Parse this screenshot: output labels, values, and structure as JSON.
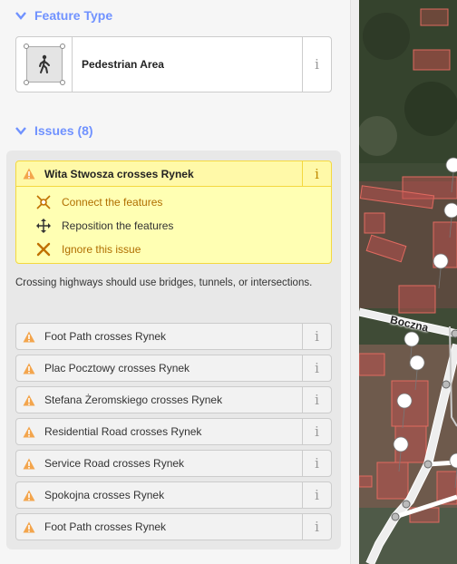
{
  "feature_type": {
    "header": "Feature Type",
    "preset_name": "Pedestrian Area",
    "info_label": "i"
  },
  "issues": {
    "header": "Issues (8)",
    "active": {
      "title": "Wita Stwosza crosses Rynek",
      "fixes": [
        {
          "label": "Connect the features",
          "icon": "connect-icon"
        },
        {
          "label": "Reposition the features",
          "icon": "move-icon"
        },
        {
          "label": "Ignore this issue",
          "icon": "ignore-icon"
        }
      ],
      "description": "Crossing highways should use bridges, tunnels, or intersections."
    },
    "list": [
      {
        "label": "Foot Path crosses Rynek"
      },
      {
        "label": "Plac Pocztowy crosses Rynek"
      },
      {
        "label": "Stefana Żeromskiego crosses Rynek"
      },
      {
        "label": "Residential Road crosses Rynek"
      },
      {
        "label": "Service Road crosses Rynek"
      },
      {
        "label": "Spokojna crosses Rynek"
      },
      {
        "label": "Foot Path crosses Rynek"
      }
    ]
  },
  "map": {
    "street_label": "Boczna"
  },
  "colors": {
    "accent": "#7092ff",
    "warning": "#f3a54d",
    "warning_bg": "#ffffb3"
  }
}
